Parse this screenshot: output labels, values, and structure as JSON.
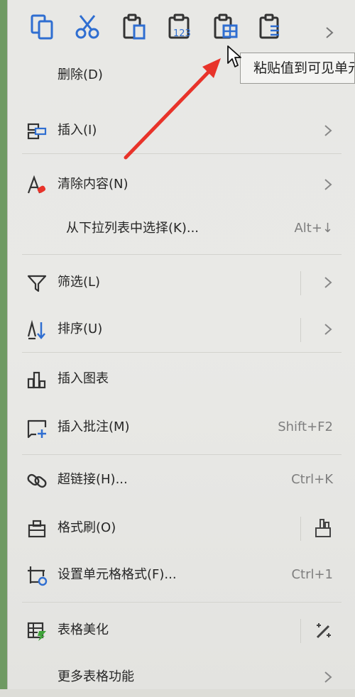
{
  "toolbar": {
    "buttons": [
      {
        "name": "copy-button",
        "icon": "copy-icon"
      },
      {
        "name": "cut-button",
        "icon": "scissors-icon"
      },
      {
        "name": "paste-button",
        "icon": "clipboard-icon"
      },
      {
        "name": "paste-values-button",
        "icon": "clipboard-123-icon",
        "badge": "123"
      },
      {
        "name": "paste-visible-button",
        "icon": "clipboard-grid-icon"
      },
      {
        "name": "paste-special-button",
        "icon": "clipboard-list-icon"
      }
    ],
    "more_icon": "chevron-right-icon"
  },
  "tooltip": "粘贴值到可见单元格",
  "menu": {
    "delete": {
      "label": "删除(D)"
    },
    "insert": {
      "label": "插入(I)"
    },
    "clear": {
      "label": "清除内容(N)"
    },
    "pick_list": {
      "label": "从下拉列表中选择(K)...",
      "shortcut": "Alt+↓"
    },
    "filter": {
      "label": "筛选(L)"
    },
    "sort": {
      "label": "排序(U)"
    },
    "insert_chart": {
      "label": "插入图表"
    },
    "insert_comment": {
      "label": "插入批注(M)",
      "shortcut": "Shift+F2"
    },
    "hyperlink": {
      "label": "超链接(H)...",
      "shortcut": "Ctrl+K"
    },
    "format_painter": {
      "label": "格式刷(O)"
    },
    "format_cells": {
      "label": "设置单元格格式(F)...",
      "shortcut": "Ctrl+1"
    },
    "beautify": {
      "label": "表格美化"
    },
    "more": {
      "label": "更多表格功能"
    }
  },
  "colors": {
    "icon_blue": "#2f6ed1",
    "arrow_red": "#e8332a",
    "text": "#262626",
    "shortcut": "#7e7e7e"
  }
}
